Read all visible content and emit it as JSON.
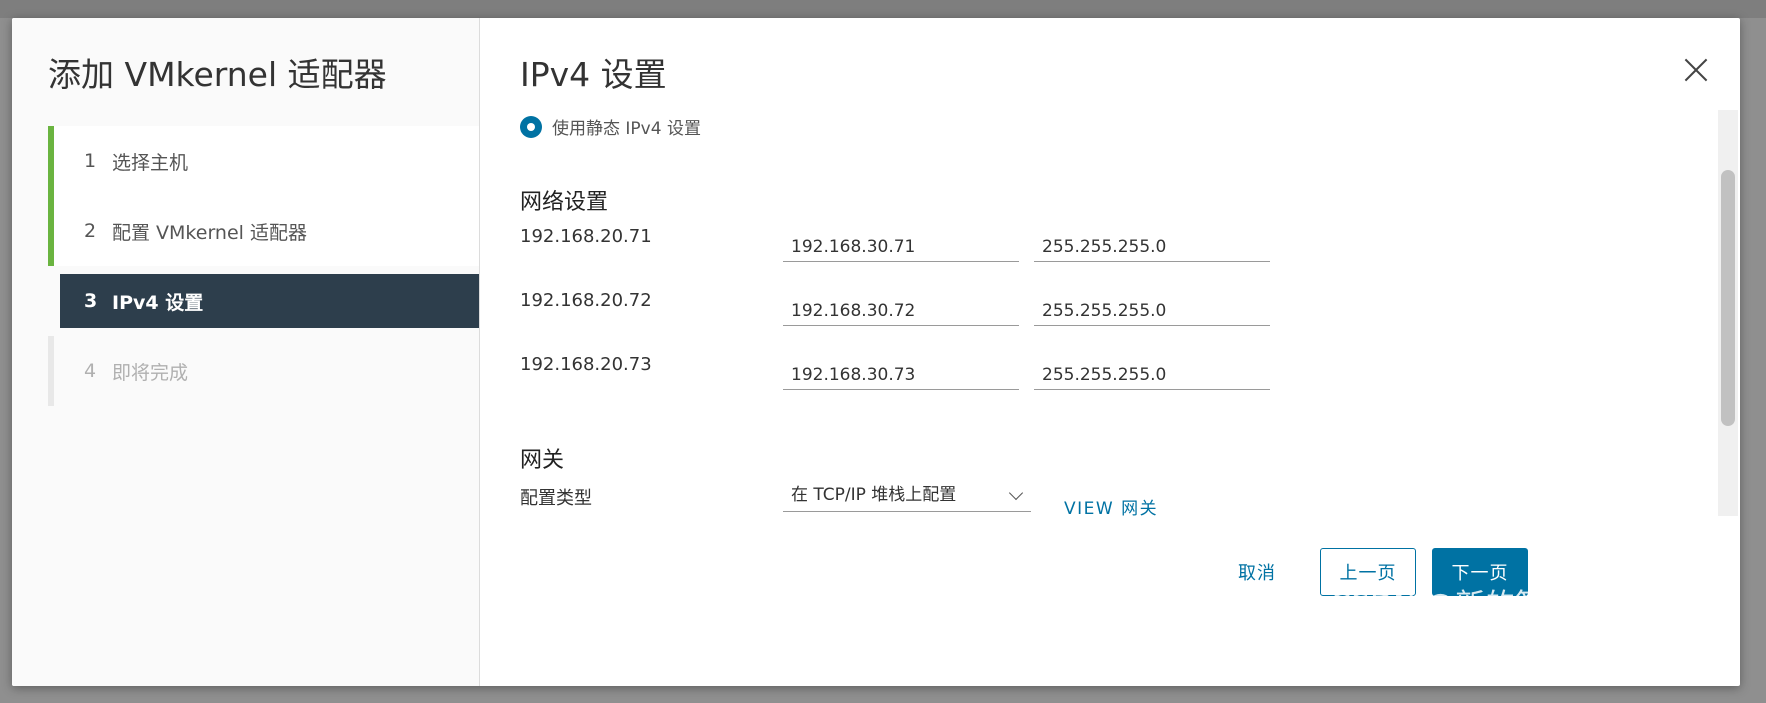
{
  "wizard": {
    "title": "添加 VMkernel 适配器",
    "steps": [
      {
        "num": "1",
        "label": "选择主机",
        "state": "done"
      },
      {
        "num": "2",
        "label": "配置 VMkernel 适配器",
        "state": "done"
      },
      {
        "num": "3",
        "label": "IPv4 设置",
        "state": "current"
      },
      {
        "num": "4",
        "label": "即将完成",
        "state": "pending"
      }
    ]
  },
  "page": {
    "title": "IPv4 设置",
    "static_option_label": "使用静态 IPv4 设置",
    "network_section_title": "网络设置",
    "hosts": [
      {
        "host": "192.168.20.71",
        "ip": "192.168.30.71",
        "mask": "255.255.255.0"
      },
      {
        "host": "192.168.20.72",
        "ip": "192.168.30.72",
        "mask": "255.255.255.0"
      },
      {
        "host": "192.168.20.73",
        "ip": "192.168.30.73",
        "mask": "255.255.255.0"
      }
    ],
    "gateway_section_title": "网关",
    "config_type_label": "配置类型",
    "config_type_value": "在 TCP/IP 堆栈上配置",
    "view_gateway_link": "VIEW 网关"
  },
  "footer": {
    "cancel": "取消",
    "prev": "上一页",
    "next": "下一页"
  },
  "watermark": "CSDN @新的算法",
  "colors": {
    "primary": "#0072a3",
    "done_rail": "#6ab440",
    "current_step_bg": "#2d3e4c"
  }
}
